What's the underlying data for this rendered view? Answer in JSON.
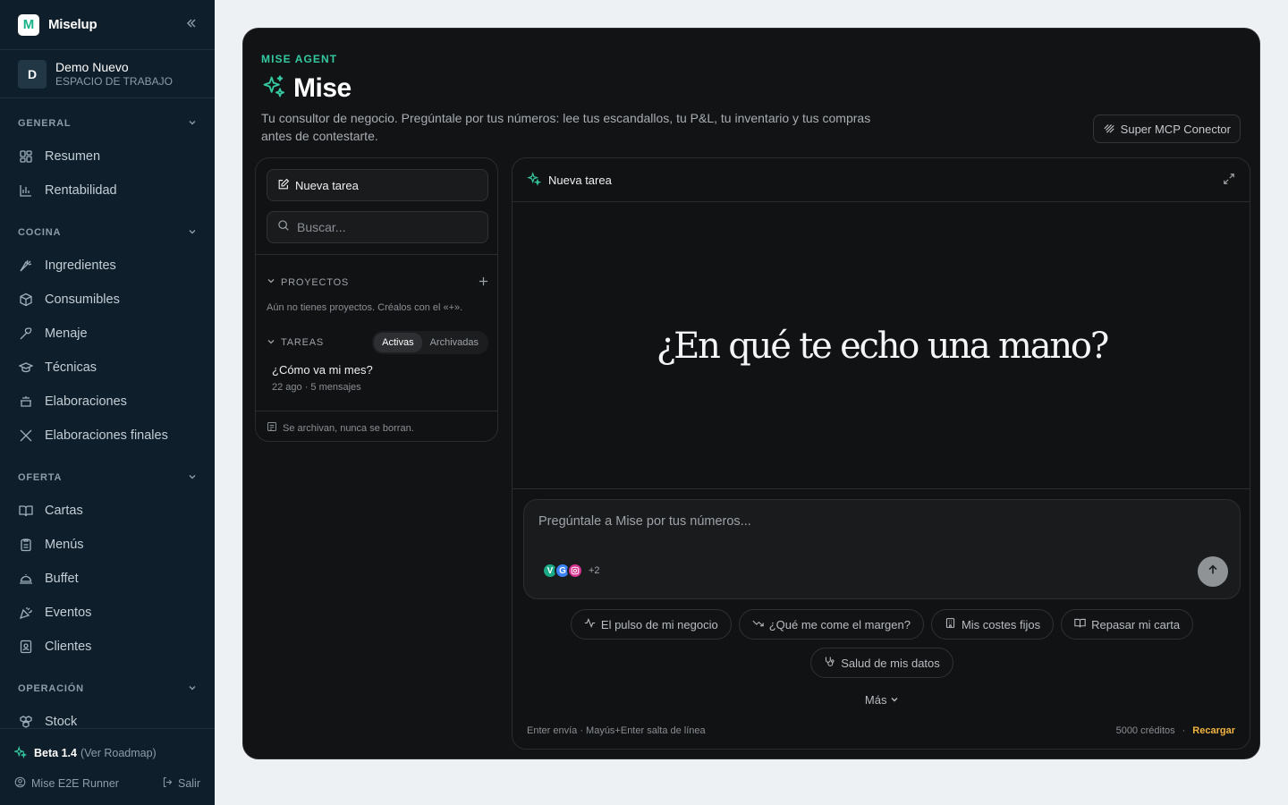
{
  "sidebar": {
    "brand": "Miselup",
    "workspace": {
      "initial": "D",
      "name": "Demo Nuevo",
      "label": "ESPACIO DE TRABAJO"
    },
    "sections": {
      "general": {
        "label": "GENERAL",
        "items": [
          "Resumen",
          "Rentabilidad"
        ]
      },
      "cocina": {
        "label": "COCINA",
        "items": [
          "Ingredientes",
          "Consumibles",
          "Menaje",
          "Técnicas",
          "Elaboraciones",
          "Elaboraciones finales"
        ]
      },
      "oferta": {
        "label": "OFERTA",
        "items": [
          "Cartas",
          "Menús",
          "Buffet",
          "Eventos",
          "Clientes"
        ]
      },
      "operacion": {
        "label": "OPERACIÓN",
        "items": [
          "Stock"
        ]
      }
    },
    "footer": {
      "beta": "Beta 1.4",
      "roadmap": "(Ver Roadmap)",
      "user": "Mise E2E Runner",
      "logout": "Salir"
    }
  },
  "header": {
    "eyebrow": "MISE AGENT",
    "title": "Mise",
    "subtitle": "Tu consultor de negocio. Pregúntale por tus números: lee tus escandallos, tu P&L, tu inventario y tus compras antes de contestarte.",
    "mcp_button": "Super MCP Conector"
  },
  "tasks_panel": {
    "new_task": "Nueva tarea",
    "search_placeholder": "Buscar...",
    "projects_label": "PROYECTOS",
    "projects_empty": "Aún no tienes proyectos. Créalos con el «+».",
    "tasks_label": "TAREAS",
    "tabs": [
      "Activas",
      "Archivadas"
    ],
    "active_tab": "Activas",
    "tasks": [
      {
        "title": "¿Cómo va mi mes?",
        "meta": "22 ago · 5 mensajes"
      }
    ],
    "archive_note": "Se archivan, nunca se borran."
  },
  "chat": {
    "title": "Nueva tarea",
    "hero": "¿En qué te echo una mano?",
    "input_placeholder": "Pregúntale a Mise por tus números...",
    "integrations_more": "+2",
    "suggestions": [
      "El pulso de mi negocio",
      "¿Qué me come el margen?",
      "Mis costes fijos",
      "Repasar mi carta",
      "Salud de mis datos"
    ],
    "more": "Más",
    "hint": "Enter envía · Mayús+Enter salta de línea",
    "credits": "5000 créditos",
    "dot": "·",
    "recharge": "Recargar"
  },
  "colors": {
    "sidebar_bg": "#0e1e2a",
    "panel_bg": "#121314",
    "accent": "#34c9a0",
    "recharge": "#f2b441"
  }
}
